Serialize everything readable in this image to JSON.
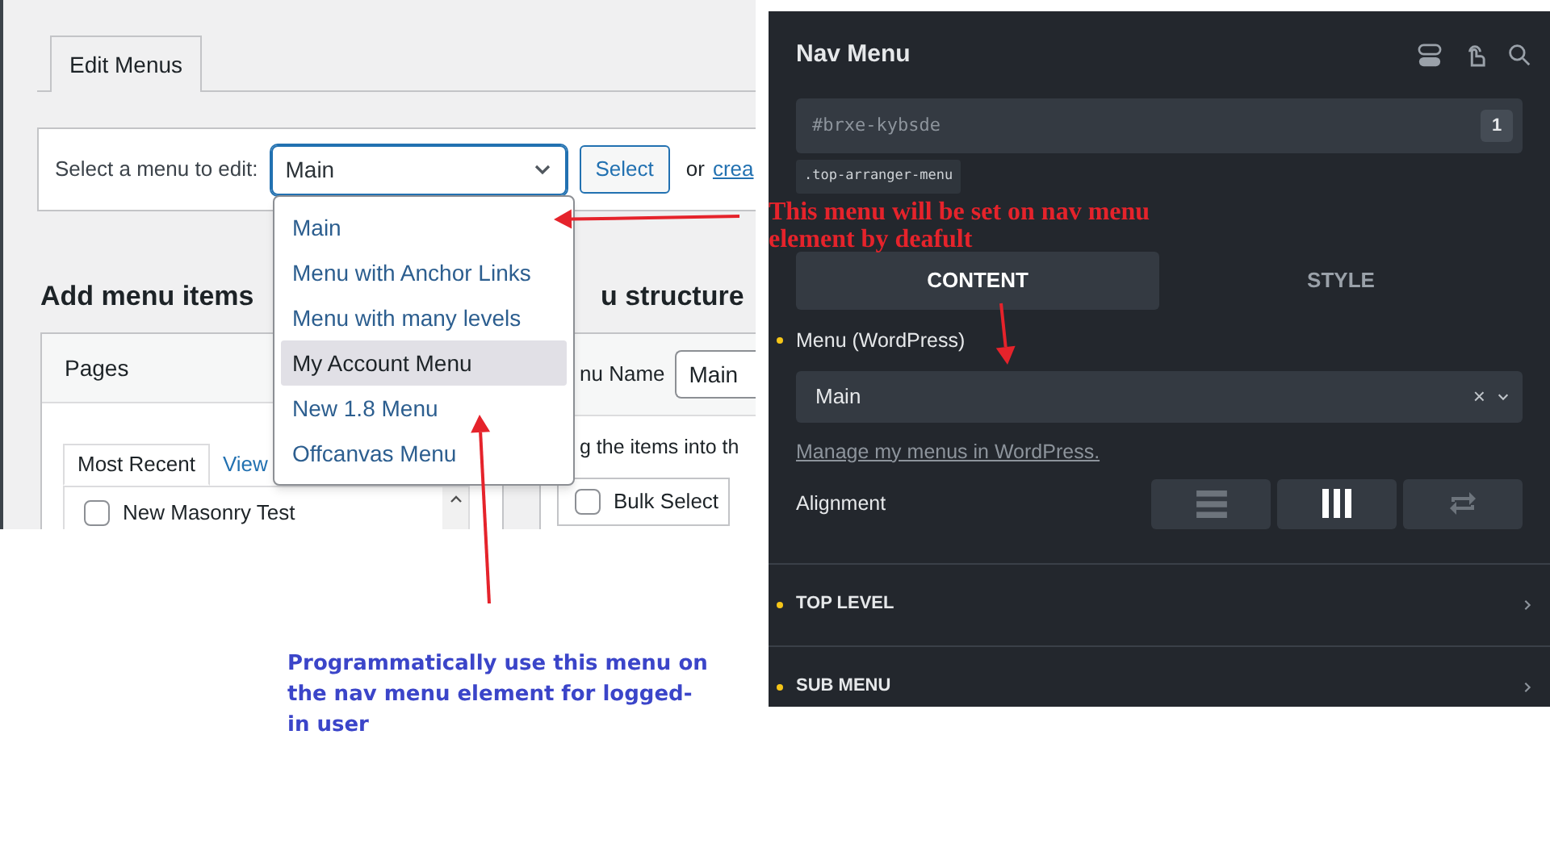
{
  "edit_menus": {
    "tabs": [
      {
        "label": "Edit Menus",
        "selected": true
      }
    ],
    "menu_select": {
      "label": "Select a menu to edit:",
      "value": "Main",
      "button": "Select",
      "or_text": "or",
      "create_link": "crea"
    },
    "dropdown": [
      {
        "label": "Main",
        "selected": false
      },
      {
        "label": "Menu with Anchor Links",
        "selected": false
      },
      {
        "label": "Menu with many levels",
        "selected": false
      },
      {
        "label": "My Account Menu",
        "selected": true
      },
      {
        "label": "New 1.8 Menu",
        "selected": false
      },
      {
        "label": "Offcanvas Menu",
        "selected": false
      }
    ],
    "add_menu_items": {
      "heading": "Add menu items",
      "panel_title": "Pages",
      "tabs": [
        {
          "label": "Most Recent",
          "selected": true
        },
        {
          "label": "View",
          "selected": false
        }
      ],
      "items": [
        {
          "label": "New Masonry Test",
          "checked": false
        }
      ]
    },
    "menu_structure": {
      "heading": "u structure",
      "name_label": "nu Name",
      "name_value": "Main",
      "hint": "g the items into th",
      "bulk_select": {
        "label": "Bulk Select",
        "checked": false
      }
    }
  },
  "nav_menu": {
    "title": "Nav Menu",
    "element_id": "#brxe-kybsde",
    "id_badge": "1",
    "class_tag": ".top-arranger-menu",
    "tabs": [
      {
        "label": "CONTENT",
        "selected": true
      },
      {
        "label": "STYLE",
        "selected": false
      }
    ],
    "menu_field": {
      "label": "Menu (WordPress)",
      "value": "Main",
      "clear": "×"
    },
    "manage_link": "Manage my menus in WordPress.",
    "alignment": {
      "label": "Alignment",
      "options": [
        {
          "kind": "rows",
          "selected": false
        },
        {
          "kind": "columns",
          "selected": true
        },
        {
          "kind": "wrap",
          "selected": false
        }
      ]
    },
    "sections": [
      {
        "title": "TOP LEVEL",
        "expanded": false
      },
      {
        "title": "SUB MENU",
        "expanded": false
      }
    ]
  },
  "annotations": [
    {
      "text": "This menu will be set on nav menu element by deafult",
      "color": "#e5232b"
    },
    {
      "text": "Programmatically use this menu on the nav menu element for logged-in user",
      "color": "#3b45c9"
    }
  ]
}
